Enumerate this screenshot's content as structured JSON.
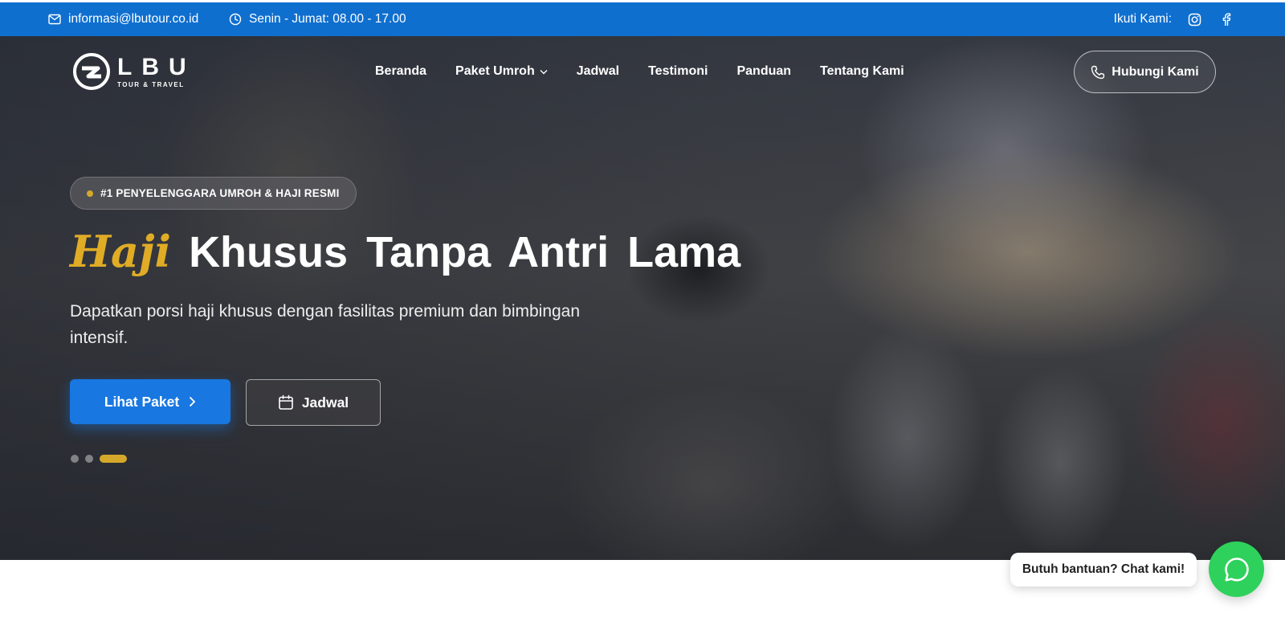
{
  "topbar": {
    "email": "informasi@lbutour.co.id",
    "hours": "Senin - Jumat: 08.00 - 17.00",
    "follow_label": "Ikuti Kami:",
    "socials": [
      "instagram-icon",
      "facebook-icon"
    ]
  },
  "brand": {
    "name": "LBU",
    "tagline": "TOUR & TRAVEL"
  },
  "nav": {
    "items": [
      {
        "label": "Beranda"
      },
      {
        "label": "Paket Umroh",
        "has_dropdown": true
      },
      {
        "label": "Jadwal"
      },
      {
        "label": "Testimoni"
      },
      {
        "label": "Panduan"
      },
      {
        "label": "Tentang Kami"
      }
    ],
    "contact_button": "Hubungi Kami"
  },
  "hero": {
    "badge": "#1 PENYELENGGARA UMROH & HAJI RESMI",
    "headline_accent": "Haji",
    "headline_rest": "Khusus Tanpa Antri Lama",
    "subtext": "Dapatkan porsi haji khusus dengan fasilitas premium dan bimbingan intensif.",
    "primary_button": "Lihat Paket",
    "secondary_button": "Jadwal",
    "slides": {
      "count": 3,
      "active": 3
    }
  },
  "chat": {
    "prompt": "Butuh bantuan? Chat kami!"
  },
  "colors": {
    "topbar": "#0f6fcf",
    "primary": "#1877e0",
    "accent": "#e0ac26",
    "whatsapp": "#2ed15b"
  }
}
